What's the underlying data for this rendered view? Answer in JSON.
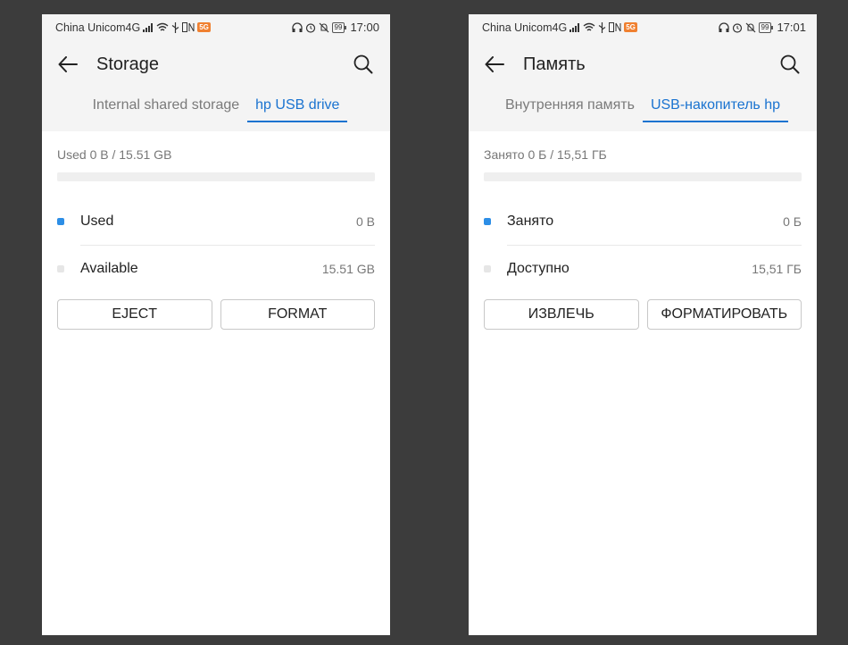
{
  "colors": {
    "accent": "#1a73d0",
    "used_dot": "#2d8ee6",
    "available_dot": "#e6e6e6",
    "background": "#3c3c3c"
  },
  "phones": [
    {
      "status": {
        "carrier": "China Unicom4G",
        "net": "4G",
        "battery": "99",
        "time": "17:00"
      },
      "appbar": {
        "title": "Storage",
        "back_icon": "arrow-back-icon",
        "search_icon": "search-icon"
      },
      "tabs": [
        {
          "label": "Internal shared storage",
          "active": false
        },
        {
          "label": "hp USB drive",
          "active": true
        }
      ],
      "summary": "Used 0 B / 15.51 GB",
      "used_fraction": 0,
      "rows": [
        {
          "label": "Used",
          "value": "0 B"
        },
        {
          "label": "Available",
          "value": "15.51 GB"
        }
      ],
      "buttons": {
        "eject": "EJECT",
        "format": "FORMAT"
      }
    },
    {
      "status": {
        "carrier": "China Unicom4G",
        "net": "4G",
        "battery": "99",
        "time": "17:01"
      },
      "appbar": {
        "title": "Память",
        "back_icon": "arrow-back-icon",
        "search_icon": "search-icon"
      },
      "tabs": [
        {
          "label": "Внутренняя память",
          "active": false
        },
        {
          "label": "USB-накопитель hp",
          "active": true
        }
      ],
      "summary": "Занято 0 Б / 15,51 ГБ",
      "used_fraction": 0,
      "rows": [
        {
          "label": "Занято",
          "value": "0 Б"
        },
        {
          "label": "Доступно",
          "value": "15,51 ГБ"
        }
      ],
      "buttons": {
        "eject": "ИЗВЛЕЧЬ",
        "format": "ФОРМАТИРОВАТЬ"
      }
    }
  ]
}
